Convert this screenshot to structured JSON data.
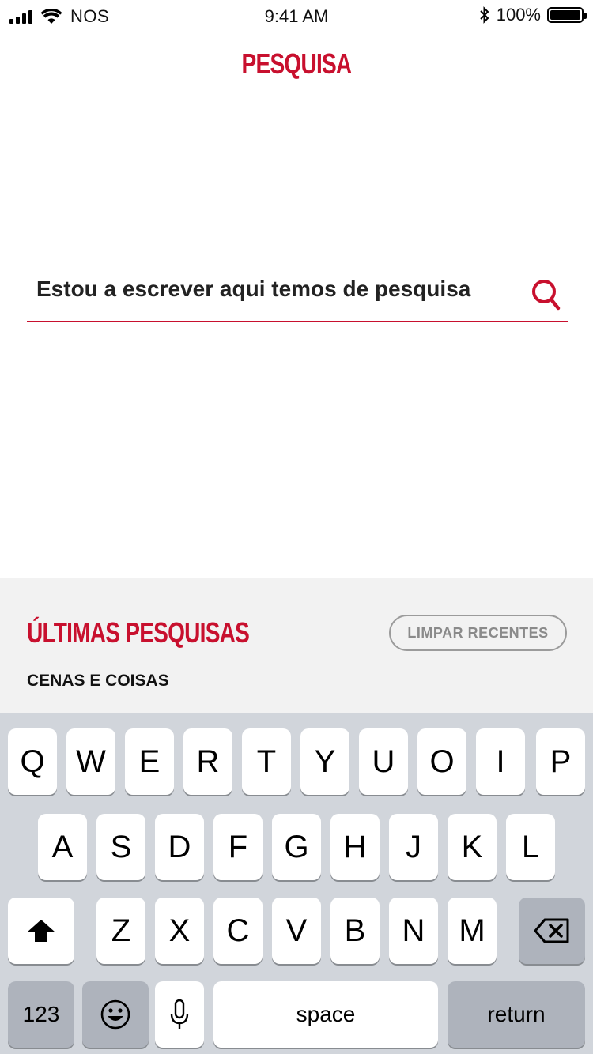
{
  "status_bar": {
    "carrier": "NOS",
    "time": "9:41 AM",
    "battery": "100%"
  },
  "header": {
    "title": "PESQUISA"
  },
  "search": {
    "value": "Estou a escrever aqui temos de pesquisa",
    "icon": "search-icon"
  },
  "recents": {
    "title": "ÚLTIMAS PESQUISAS",
    "clear_label": "LIMPAR RECENTES",
    "items": [
      "CENAS E COISAS"
    ]
  },
  "keyboard": {
    "row1": [
      "Q",
      "W",
      "E",
      "R",
      "T",
      "Y",
      "U",
      "O",
      "I",
      "P"
    ],
    "row2": [
      "A",
      "S",
      "D",
      "F",
      "G",
      "H",
      "J",
      "K",
      "L"
    ],
    "row3": [
      "Z",
      "X",
      "C",
      "V",
      "B",
      "N",
      "M"
    ],
    "numbers_label": "123",
    "space_label": "space",
    "return_label": "return"
  },
  "colors": {
    "accent": "#c8102e",
    "panel": "#f2f2f2",
    "keyboard": "#d1d5db"
  }
}
